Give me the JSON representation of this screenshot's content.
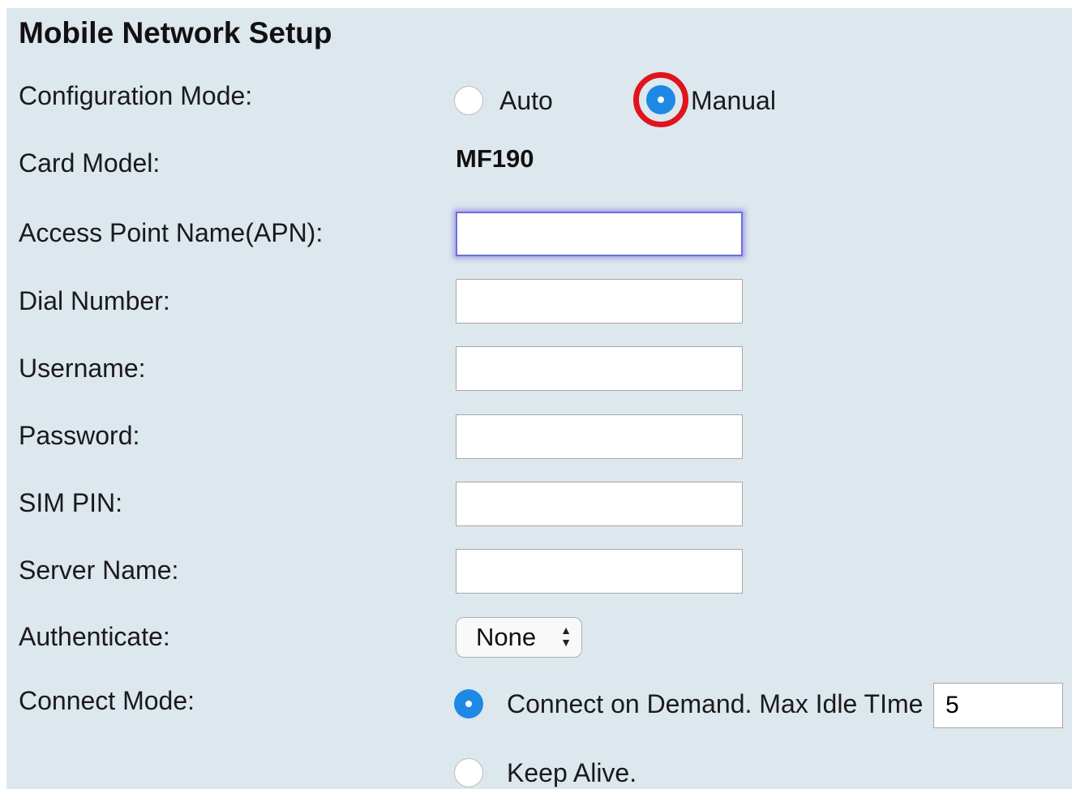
{
  "page": {
    "title": "Mobile Network Setup"
  },
  "config_mode": {
    "label": "Configuration Mode:",
    "options": [
      {
        "label": "Auto",
        "checked": false
      },
      {
        "label": "Manual",
        "checked": true
      }
    ]
  },
  "card_model": {
    "label": "Card Model:",
    "value": "MF190"
  },
  "fields": {
    "apn": {
      "label": "Access Point Name(APN):",
      "value": ""
    },
    "dial_number": {
      "label": "Dial Number:",
      "value": ""
    },
    "username": {
      "label": "Username:",
      "value": ""
    },
    "password": {
      "label": "Password:",
      "value": ""
    },
    "sim_pin": {
      "label": "SIM PIN:",
      "value": ""
    },
    "server_name": {
      "label": "Server Name:",
      "value": ""
    }
  },
  "authenticate": {
    "label": "Authenticate:",
    "selected": "None"
  },
  "connect_mode": {
    "label": "Connect Mode:",
    "on_demand": {
      "label": "Connect on Demand. Max Idle TIme",
      "checked": true,
      "idle_value": "5"
    },
    "keep_alive": {
      "label": "Keep Alive.",
      "checked": false
    }
  },
  "colors": {
    "panel_bg": "#dde7ee",
    "radio_checked": "#1e88e5",
    "highlight_ring": "#e0141c"
  }
}
